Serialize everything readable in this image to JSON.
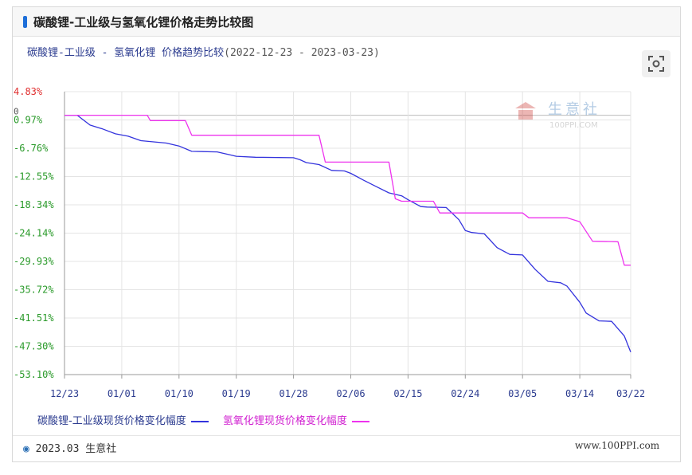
{
  "header": {
    "title": "碳酸锂-工业级与氢氧化锂价格走势比较图"
  },
  "chart_title": {
    "main": "碳酸锂-工业级 - 氢氧化锂 价格趋势比较",
    "period": "(2022-12-23 - 2023-03-23)"
  },
  "watermark": {
    "cn": "生意社",
    "en": "100PPI.COM"
  },
  "footer": {
    "left": "2023.03 生意社",
    "right": "www.100PPI.com"
  },
  "colors": {
    "series1": "#3333dd",
    "series2": "#ee33ee",
    "negative_label": "#2a9a2a",
    "positive_label": "#e03030"
  },
  "chart_data": {
    "type": "line",
    "title": "碳酸锂-工业级 - 氢氧化锂 价格趋势比较(2022-12-23 - 2023-03-23)",
    "xlabel": "",
    "ylabel": "",
    "y_ticks": [
      "4.83%",
      "0.97%",
      "-6.76%",
      "-12.55%",
      "-18.34%",
      "-24.14%",
      "-29.93%",
      "-35.72%",
      "-41.51%",
      "-47.30%",
      "-53.10%"
    ],
    "y_tick_values": [
      4.83,
      -0.97,
      -6.76,
      -12.55,
      -18.34,
      -24.14,
      -29.93,
      -35.72,
      -41.51,
      -47.3,
      -53.1
    ],
    "zero_label": "0",
    "ylim": [
      -53.1,
      4.83
    ],
    "x_ticks": [
      "12/23",
      "01/01",
      "01/10",
      "01/19",
      "01/28",
      "02/06",
      "02/15",
      "02/24",
      "03/05",
      "03/14",
      "03/22"
    ],
    "x_tick_days": [
      0,
      9,
      18,
      27,
      36,
      45,
      54,
      63,
      72,
      81,
      89
    ],
    "xlim_days": [
      0,
      89
    ],
    "grid": true,
    "legend_position": "bottom",
    "series": [
      {
        "name": "碳酸锂-工业级现货价格变化幅度",
        "color": "#3333dd",
        "points": [
          [
            0,
            0
          ],
          [
            2,
            0
          ],
          [
            4,
            -2
          ],
          [
            6,
            -2.8
          ],
          [
            8,
            -3.8
          ],
          [
            10,
            -4.3
          ],
          [
            12,
            -5.2
          ],
          [
            16,
            -5.7
          ],
          [
            18,
            -6.3
          ],
          [
            20,
            -7.4
          ],
          [
            24,
            -7.5
          ],
          [
            26,
            -8.1
          ],
          [
            27,
            -8.4
          ],
          [
            30,
            -8.6
          ],
          [
            36,
            -8.7
          ],
          [
            37,
            -9.1
          ],
          [
            38,
            -9.7
          ],
          [
            40,
            -10.1
          ],
          [
            42,
            -11.3
          ],
          [
            44,
            -11.4
          ],
          [
            45,
            -11.9
          ],
          [
            47,
            -13.3
          ],
          [
            49,
            -14.6
          ],
          [
            51,
            -15.9
          ],
          [
            53,
            -16.5
          ],
          [
            54,
            -17.3
          ],
          [
            56,
            -18.7
          ],
          [
            57,
            -18.8
          ],
          [
            60,
            -18.9
          ],
          [
            62,
            -21.4
          ],
          [
            63,
            -23.6
          ],
          [
            64,
            -24.0
          ],
          [
            66,
            -24.3
          ],
          [
            68,
            -27.1
          ],
          [
            70,
            -28.5
          ],
          [
            72,
            -28.6
          ],
          [
            74,
            -31.6
          ],
          [
            76,
            -34.0
          ],
          [
            78,
            -34.3
          ],
          [
            79,
            -35.0
          ],
          [
            81,
            -38.3
          ],
          [
            82,
            -40.5
          ],
          [
            84,
            -42.1
          ],
          [
            86,
            -42.2
          ],
          [
            88,
            -45.2
          ],
          [
            89,
            -48.5
          ]
        ]
      },
      {
        "name": "氢氧化锂现货价格变化幅度",
        "color": "#ee33ee",
        "points": [
          [
            0,
            0
          ],
          [
            13,
            0
          ],
          [
            13.5,
            -1.1
          ],
          [
            19,
            -1.1
          ],
          [
            20,
            -4.1
          ],
          [
            40,
            -4.1
          ],
          [
            41,
            -9.6
          ],
          [
            51,
            -9.6
          ],
          [
            52,
            -17.1
          ],
          [
            53,
            -17.6
          ],
          [
            58,
            -17.6
          ],
          [
            59,
            -20.0
          ],
          [
            72,
            -20.0
          ],
          [
            73,
            -21.0
          ],
          [
            79,
            -21.0
          ],
          [
            81,
            -21.8
          ],
          [
            83,
            -25.8
          ],
          [
            87,
            -25.9
          ],
          [
            88,
            -30.7
          ],
          [
            89,
            -30.7
          ]
        ]
      }
    ]
  }
}
